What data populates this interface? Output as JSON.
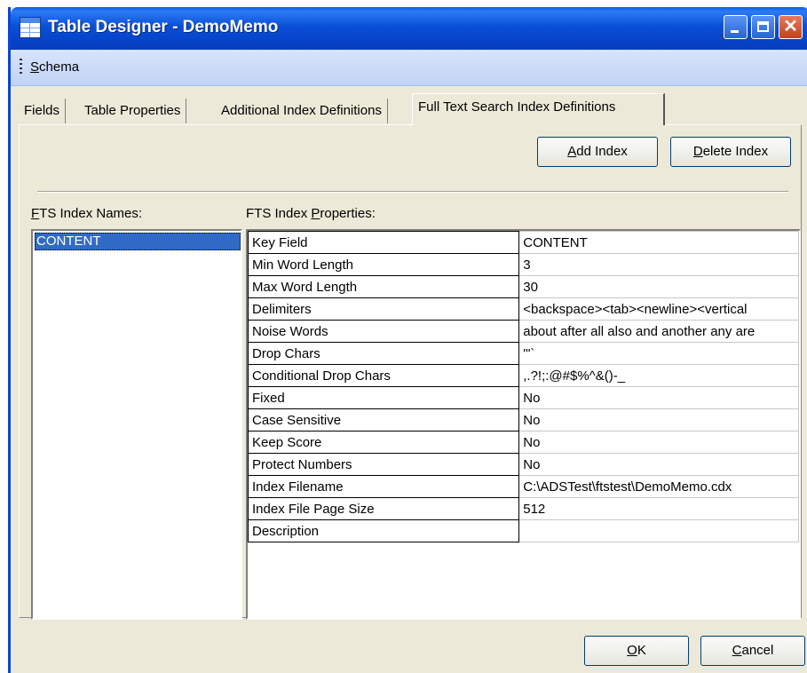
{
  "window": {
    "title": "Table Designer - DemoMemo",
    "controls": [
      "minimize",
      "maximize",
      "close"
    ]
  },
  "menu": {
    "schema_label": "Schema",
    "schema_mnemonic": "S",
    "schema_rest": "chema"
  },
  "tabs": [
    {
      "label": "Fields",
      "active": false
    },
    {
      "label": "Table Properties",
      "active": false
    },
    {
      "label": "Additional Index Definitions",
      "active": false
    },
    {
      "label": "Full Text Search Index Definitions",
      "active": true
    }
  ],
  "buttons": {
    "add_index": {
      "mn": "A",
      "rest": "dd Index"
    },
    "delete_index": {
      "mn": "D",
      "rest": "elete Index"
    },
    "ok": {
      "mn": "O",
      "rest": "K"
    },
    "cancel": {
      "mn": "C",
      "rest": "ancel"
    }
  },
  "labels": {
    "names_mn": "F",
    "names_rest": "TS Index Names:",
    "props_pre": "FTS Index ",
    "props_mn": "P",
    "props_rest": "roperties:"
  },
  "index_names": [
    "CONTENT"
  ],
  "properties": [
    {
      "name": "Key Field",
      "value": "CONTENT"
    },
    {
      "name": "Min Word Length",
      "value": "3"
    },
    {
      "name": "Max Word Length",
      "value": "30"
    },
    {
      "name": "Delimiters",
      "value": "<backspace><tab><newline><vertical"
    },
    {
      "name": "Noise Words",
      "value": "about after all also and another any are"
    },
    {
      "name": "Drop Chars",
      "value": "'\"`"
    },
    {
      "name": "Conditional Drop Chars",
      "value": ",.?!;:@#$%^&()-_"
    },
    {
      "name": "Fixed",
      "value": "No"
    },
    {
      "name": "Case Sensitive",
      "value": "No"
    },
    {
      "name": "Keep Score",
      "value": "No"
    },
    {
      "name": "Protect Numbers",
      "value": "No"
    },
    {
      "name": "Index Filename",
      "value": "C:\\ADSTest\\ftstest\\DemoMemo.cdx"
    },
    {
      "name": "Index File Page Size",
      "value": "512"
    },
    {
      "name": "Description",
      "value": ""
    }
  ]
}
